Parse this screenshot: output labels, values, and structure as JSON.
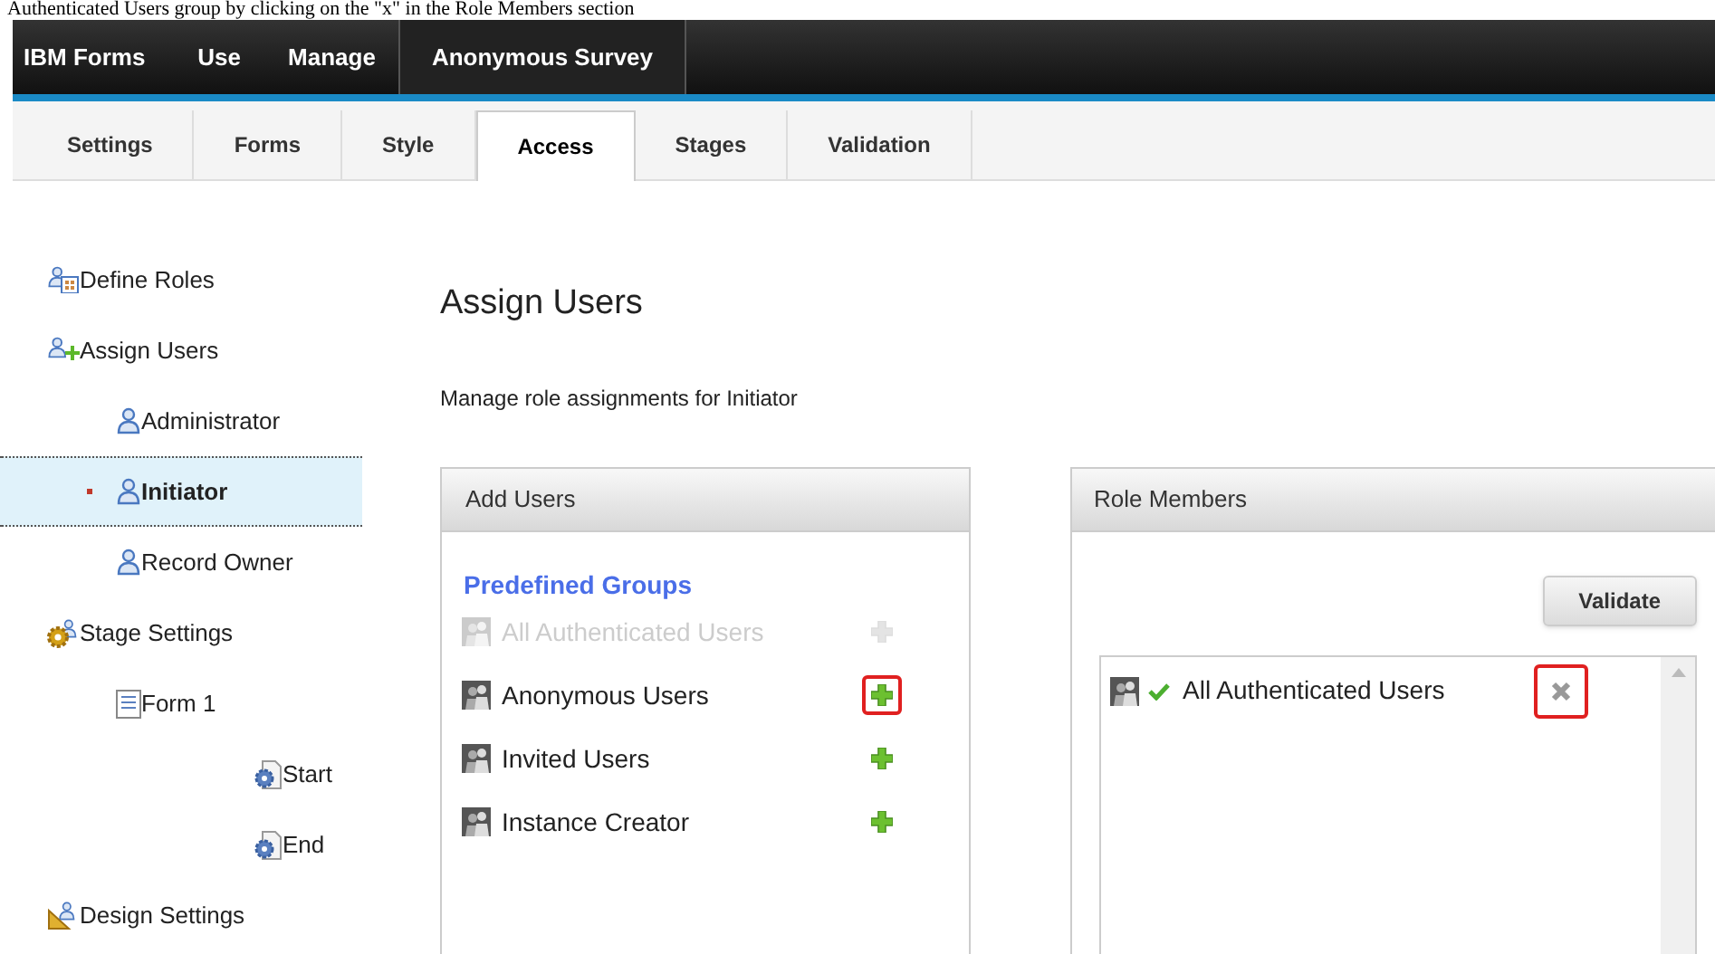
{
  "caption": "Authenticated Users group by clicking on the \"x\" in the Role Members section",
  "nav": {
    "brand": "IBM Forms",
    "items": [
      {
        "label": "Use",
        "selected": false
      },
      {
        "label": "Manage",
        "selected": false
      },
      {
        "label": "Anonymous Survey",
        "selected": true
      }
    ]
  },
  "tabs": [
    {
      "label": "Settings",
      "selected": false
    },
    {
      "label": "Forms",
      "selected": false
    },
    {
      "label": "Style",
      "selected": false
    },
    {
      "label": "Access",
      "selected": true
    },
    {
      "label": "Stages",
      "selected": false
    },
    {
      "label": "Validation",
      "selected": false
    }
  ],
  "sidebar": {
    "items": [
      {
        "label": "Define Roles",
        "kind": "roles",
        "selected": false
      },
      {
        "label": "Assign Users",
        "kind": "assign",
        "selected": false,
        "children": [
          {
            "label": "Administrator",
            "kind": "user",
            "selected": false
          },
          {
            "label": "Initiator",
            "kind": "user",
            "selected": true
          },
          {
            "label": "Record Owner",
            "kind": "user",
            "selected": false
          }
        ]
      },
      {
        "label": "Stage Settings",
        "kind": "stage",
        "selected": false,
        "children": [
          {
            "label": "Form 1",
            "kind": "form",
            "selected": false,
            "children": [
              {
                "label": "Start",
                "kind": "step",
                "selected": false
              },
              {
                "label": "End",
                "kind": "step",
                "selected": false
              }
            ]
          }
        ]
      },
      {
        "label": "Design Settings",
        "kind": "design",
        "selected": false
      }
    ]
  },
  "main": {
    "title": "Assign Users",
    "subtitle": "Manage role assignments for Initiator"
  },
  "add_users": {
    "title": "Add Users",
    "section": "Predefined Groups",
    "groups": [
      {
        "name": "All Authenticated Users",
        "disabled": true,
        "highlighted": false
      },
      {
        "name": "Anonymous Users",
        "disabled": false,
        "highlighted": true
      },
      {
        "name": "Invited Users",
        "disabled": false,
        "highlighted": false
      },
      {
        "name": "Instance Creator",
        "disabled": false,
        "highlighted": false
      }
    ]
  },
  "role_members": {
    "title": "Role Members",
    "button": "Validate",
    "members": [
      {
        "name": "All Authenticated Users",
        "highlighted": true
      }
    ]
  }
}
